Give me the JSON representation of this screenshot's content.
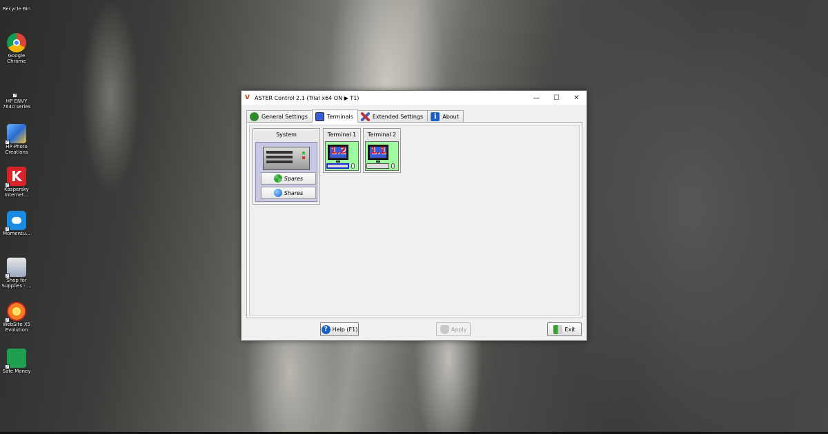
{
  "desktop": {
    "icons": [
      {
        "label": "Recycle Bin",
        "icon": "recycle-bin-icon"
      },
      {
        "label": "Google Chrome",
        "icon": "chrome-icon"
      },
      {
        "label": "HP ENVY 7640 series",
        "icon": "printer-icon"
      },
      {
        "label": "HP Photo Creations",
        "icon": "photo-icon"
      },
      {
        "label": "Kaspersky Internet...",
        "icon": "kaspersky-icon"
      },
      {
        "label": "Momentu...",
        "icon": "cloud-icon"
      },
      {
        "label": "Shop for Supplies - ...",
        "icon": "shop-icon"
      },
      {
        "label": "WebSite X5 Evolution",
        "icon": "website-x5-icon"
      },
      {
        "label": "Safe Money",
        "icon": "safe-money-icon"
      }
    ]
  },
  "window": {
    "title": "ASTER Control 2.1 (Trial x64 ON ▶ T1)",
    "controls": {
      "minimize": "—",
      "maximize": "☐",
      "close": "✕"
    },
    "tabs": [
      {
        "label": "General Settings",
        "icon": "general-settings-icon",
        "color": "#2e8b2e"
      },
      {
        "label": "Terminals",
        "icon": "terminals-icon",
        "color": "#3a5ad8"
      },
      {
        "label": "Extended Settings",
        "icon": "tools-icon",
        "color": "#c03030"
      },
      {
        "label": "About",
        "icon": "info-icon",
        "color": "#1a5ec7"
      }
    ],
    "active_tab": "Terminals",
    "system": {
      "label": "System",
      "spares_label": "Spares",
      "shares_label": "Shares"
    },
    "terminals": [
      {
        "label": "Terminal 1",
        "screen": "1.2",
        "selected": true
      },
      {
        "label": "Terminal 2",
        "screen": "1.1",
        "selected": false
      }
    ],
    "buttons": {
      "help": "Help (F1)",
      "apply": "Apply",
      "exit": "Exit"
    }
  }
}
